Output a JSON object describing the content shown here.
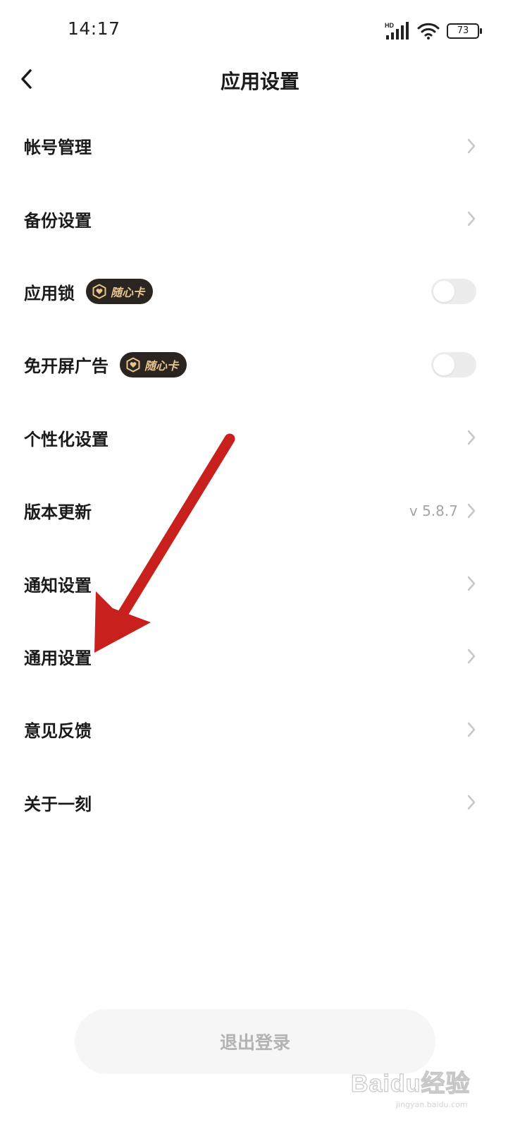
{
  "status_bar": {
    "time": "14:17",
    "network_label": "HD",
    "battery_level": "73"
  },
  "header": {
    "title": "应用设置",
    "back_icon": "chevron-left-icon"
  },
  "settings": {
    "items": [
      {
        "label": "帐号管理",
        "control": "chevron"
      },
      {
        "label": "备份设置",
        "control": "chevron"
      },
      {
        "label": "应用锁",
        "badge": "随心卡",
        "control": "toggle",
        "toggle_on": false
      },
      {
        "label": "免开屏广告",
        "badge": "随心卡",
        "control": "toggle",
        "toggle_on": false
      },
      {
        "label": "个性化设置",
        "control": "chevron"
      },
      {
        "label": "版本更新",
        "value": "v 5.8.7",
        "control": "chevron"
      },
      {
        "label": "通知设置",
        "control": "chevron"
      },
      {
        "label": "通用设置",
        "control": "chevron"
      },
      {
        "label": "意见反馈",
        "control": "chevron"
      },
      {
        "label": "关于一刻",
        "control": "chevron"
      }
    ]
  },
  "footer": {
    "logout_label": "退出登录"
  },
  "watermark": {
    "text": "Baidu经验",
    "sub": "jingyan.baidu.com"
  },
  "colors": {
    "annotation_arrow": "#c8201c",
    "badge_background": "#2b2521",
    "badge_text": "#e7c58d"
  }
}
